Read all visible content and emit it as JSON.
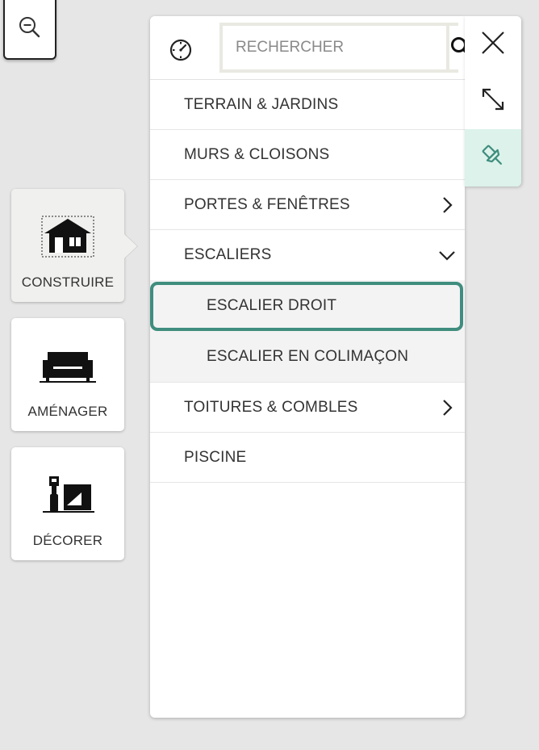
{
  "zoom": {
    "icon": "zoom-out-icon"
  },
  "categories": [
    {
      "label": "CONSTRUIRE",
      "icon": "house-icon",
      "active": true
    },
    {
      "label": "AMÉNAGER",
      "icon": "sofa-icon",
      "active": false
    },
    {
      "label": "DÉCORER",
      "icon": "paint-roller-icon",
      "active": false
    }
  ],
  "panel": {
    "timer_icon": "timer-icon",
    "search": {
      "placeholder": "RECHERCHER",
      "value": "",
      "icon": "search-icon"
    },
    "menu": [
      {
        "label": "TERRAIN & JARDINS"
      },
      {
        "label": "MURS & CLOISONS"
      },
      {
        "label": "PORTES & FENÊTRES",
        "chevron": "chevron-right-icon"
      },
      {
        "label": "ESCALIERS",
        "chevron": "chevron-down-icon",
        "expanded": true,
        "children": [
          {
            "label": "ESCALIER DROIT",
            "selected": true
          },
          {
            "label": "ESCALIER EN COLIMAÇON",
            "selected": false
          }
        ]
      },
      {
        "label": "TOITURES & COMBLES",
        "chevron": "chevron-right-icon"
      },
      {
        "label": "PISCINE"
      }
    ]
  },
  "toolbar": {
    "close_icon": "close-icon",
    "expand_icon": "expand-icon",
    "pin_icon": "pin-icon"
  },
  "colors": {
    "accent": "#3f8d7e",
    "pin_background": "#dcf2ea",
    "background": "#e6e6e6"
  }
}
